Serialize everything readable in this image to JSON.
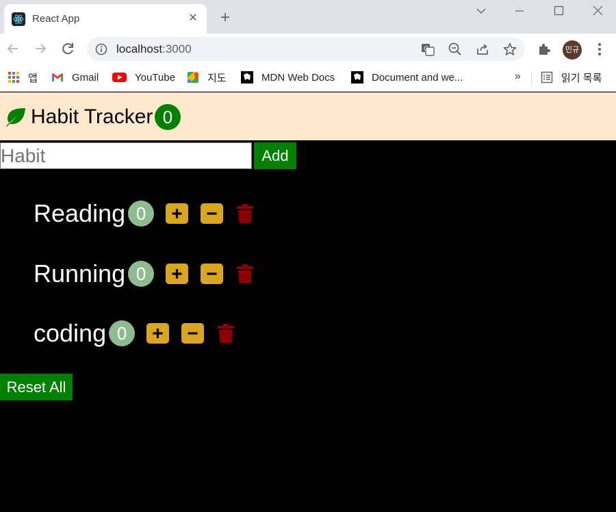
{
  "browser": {
    "tab_title": "React App",
    "url_host": "localhost",
    "url_port": ":3000",
    "avatar_text": "민규",
    "bookmarks": [
      {
        "label": "앱",
        "icon": "apps-grid-icon"
      },
      {
        "label": "Gmail",
        "icon": "gmail-icon"
      },
      {
        "label": "YouTube",
        "icon": "youtube-icon"
      },
      {
        "label": "지도",
        "icon": "maps-icon"
      },
      {
        "label": "MDN Web Docs",
        "icon": "mdn-icon"
      },
      {
        "label": "Document and we...",
        "icon": "mdn-icon"
      }
    ],
    "bookmarks_more": "»",
    "reading_list": "읽기 목록"
  },
  "app": {
    "title": "Habit Tracker",
    "total_count": "0",
    "input_placeholder": "Habit",
    "add_label": "Add",
    "reset_label": "Reset All",
    "habits": [
      {
        "name": "Reading",
        "count": "0"
      },
      {
        "name": "Running",
        "count": "0"
      },
      {
        "name": "coding",
        "count": "0"
      }
    ]
  },
  "colors": {
    "navbar_bg": "#ffe8cc",
    "accent_green": "#008000",
    "count_badge": "#8fbc8f",
    "control_gold": "#daa520",
    "trash_red": "#8b0000"
  }
}
